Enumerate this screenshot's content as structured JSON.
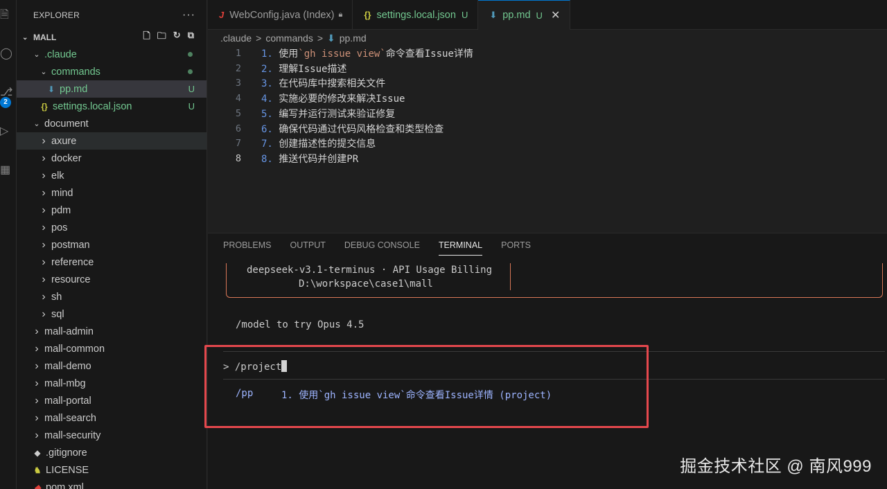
{
  "explorer": {
    "title": "EXPLORER",
    "more": "···",
    "root": "MALL",
    "tree": [
      {
        "label": ".claude",
        "indent": 1,
        "expanded": true,
        "status": "dot"
      },
      {
        "label": "commands",
        "indent": 2,
        "expanded": true,
        "status": "dot"
      },
      {
        "label": "pp.md",
        "indent": 3,
        "file": "md",
        "status": "U",
        "selected": true
      },
      {
        "label": "settings.local.json",
        "indent": 2,
        "file": "json",
        "status": "U"
      },
      {
        "label": "document",
        "indent": 1,
        "expanded": true
      },
      {
        "label": "axure",
        "indent": 2,
        "collapsed": true,
        "hover": true
      },
      {
        "label": "docker",
        "indent": 2,
        "collapsed": true
      },
      {
        "label": "elk",
        "indent": 2,
        "collapsed": true
      },
      {
        "label": "mind",
        "indent": 2,
        "collapsed": true
      },
      {
        "label": "pdm",
        "indent": 2,
        "collapsed": true
      },
      {
        "label": "pos",
        "indent": 2,
        "collapsed": true
      },
      {
        "label": "postman",
        "indent": 2,
        "collapsed": true
      },
      {
        "label": "reference",
        "indent": 2,
        "collapsed": true
      },
      {
        "label": "resource",
        "indent": 2,
        "collapsed": true
      },
      {
        "label": "sh",
        "indent": 2,
        "collapsed": true
      },
      {
        "label": "sql",
        "indent": 2,
        "collapsed": true
      },
      {
        "label": "mall-admin",
        "indent": 1,
        "collapsed": true
      },
      {
        "label": "mall-common",
        "indent": 1,
        "collapsed": true
      },
      {
        "label": "mall-demo",
        "indent": 1,
        "collapsed": true
      },
      {
        "label": "mall-mbg",
        "indent": 1,
        "collapsed": true
      },
      {
        "label": "mall-portal",
        "indent": 1,
        "collapsed": true
      },
      {
        "label": "mall-search",
        "indent": 1,
        "collapsed": true
      },
      {
        "label": "mall-security",
        "indent": 1,
        "collapsed": true
      },
      {
        "label": ".gitignore",
        "indent": 1,
        "file": "git"
      },
      {
        "label": "LICENSE",
        "indent": 1,
        "file": "license"
      },
      {
        "label": "pom.xml",
        "indent": 1,
        "file": "xml"
      }
    ],
    "badge": "2"
  },
  "tabs": [
    {
      "label": "WebConfig.java (Index)",
      "icon": "java",
      "lock": true
    },
    {
      "label": "settings.local.json",
      "icon": "json",
      "status": "U"
    },
    {
      "label": "pp.md",
      "icon": "md",
      "status": "U",
      "active": true
    }
  ],
  "breadcrumb": [
    ".claude",
    ">",
    "commands",
    ">",
    "pp.md"
  ],
  "editor": {
    "lines": [
      {
        "n": "1",
        "num": "1.",
        "pre": " 使用",
        "tick": "`gh issue view`",
        "post": "命令查看Issue详情"
      },
      {
        "n": "2",
        "num": "2.",
        "pre": " 理解Issue描述"
      },
      {
        "n": "3",
        "num": "3.",
        "pre": " 在代码库中搜索相关文件"
      },
      {
        "n": "4",
        "num": "4.",
        "pre": " 实施必要的修改来解决Issue"
      },
      {
        "n": "5",
        "num": "5.",
        "pre": " 编写并运行测试来验证修复"
      },
      {
        "n": "6",
        "num": "6.",
        "pre": " 确保代码通过代码风格检查和类型检查"
      },
      {
        "n": "7",
        "num": "7.",
        "pre": " 创建描述性的提交信息"
      },
      {
        "n": "8",
        "num": "8.",
        "pre": " 推送代码并创建PR",
        "active": true
      }
    ]
  },
  "panel": {
    "tabs": [
      "PROBLEMS",
      "OUTPUT",
      "DEBUG CONSOLE",
      "TERMINAL",
      "PORTS"
    ],
    "active_tab": "TERMINAL",
    "banner_line1": "deepseek-v3.1-terminus · API Usage Billing",
    "banner_line2": "D:\\workspace\\case1\\mall",
    "tip": "/model to try Opus 4.5",
    "prompt": "> /project",
    "suggestion_cmd": "/pp",
    "suggestion_desc": "1. 使用`gh issue view`命令查看Issue详情 (project)"
  },
  "watermark": "掘金技术社区 @ 南风999",
  "colors": {
    "accent": "#0078d4",
    "untracked": "#73c991",
    "highlight": "#e5484d",
    "claude": "#d97757"
  }
}
